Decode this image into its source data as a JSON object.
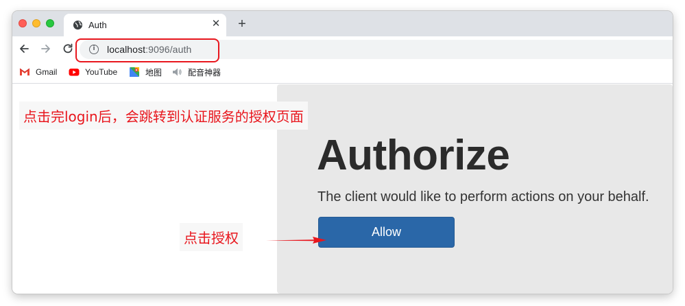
{
  "browser": {
    "tab": {
      "title": "Auth",
      "favicon": "globe-icon",
      "close_label": "✕"
    },
    "new_tab_label": "+",
    "address": {
      "host": "localhost",
      "rest": ":9096/auth"
    },
    "bookmarks": [
      {
        "label": "Gmail",
        "icon": "gmail-icon"
      },
      {
        "label": "YouTube",
        "icon": "youtube-icon"
      },
      {
        "label": "地图",
        "icon": "maps-icon"
      },
      {
        "label": "配音神器",
        "icon": "speaker-icon"
      }
    ]
  },
  "page": {
    "title": "Authorize",
    "description": "The client would like to perform actions on your behalf.",
    "allow_button": "Allow"
  },
  "annotations": {
    "top_note": "点击完login后，会跳转到认证服务的授权页面",
    "button_note": "点击授权",
    "color": "#e8161d"
  }
}
